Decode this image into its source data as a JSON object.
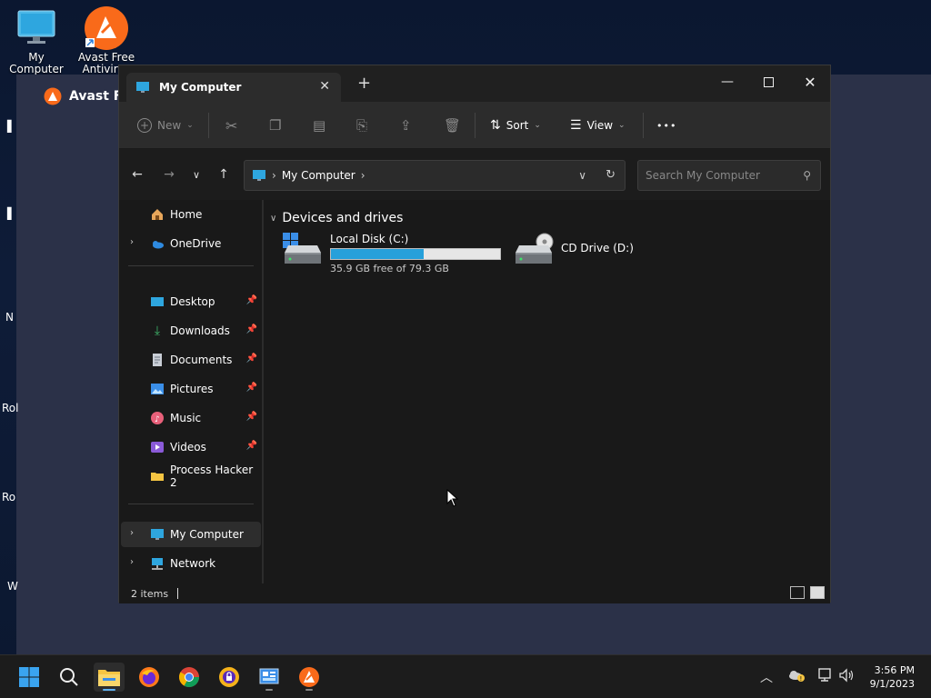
{
  "desktop": {
    "icons": [
      {
        "label": "My Computer"
      },
      {
        "label": "Avast Free Antivirus"
      }
    ],
    "strip_marks": [
      "N",
      "Rol",
      "Ro",
      "W"
    ]
  },
  "avast_window": {
    "title": "Avast Free Antivirus"
  },
  "explorer": {
    "tab_title": "My Computer",
    "new_tab": "+",
    "toolbar": {
      "new_label": "New",
      "sort_label": "Sort",
      "view_label": "View",
      "more_label": "•••"
    },
    "address": {
      "path": "My Computer"
    },
    "search": {
      "placeholder": "Search My Computer"
    },
    "sidebar": {
      "home": "Home",
      "onedrive": "OneDrive",
      "pinned": [
        {
          "label": "Desktop"
        },
        {
          "label": "Downloads"
        },
        {
          "label": "Documents"
        },
        {
          "label": "Pictures"
        },
        {
          "label": "Music"
        },
        {
          "label": "Videos"
        },
        {
          "label": "Process Hacker 2"
        }
      ],
      "my_computer": "My Computer",
      "network": "Network"
    },
    "content": {
      "group_title": "Devices and drives",
      "drives": [
        {
          "name": "Local Disk (C:)",
          "free_text": "35.9 GB free of 79.3 GB",
          "used_fraction": 0.547
        },
        {
          "name": "CD Drive (D:)"
        }
      ]
    },
    "status": {
      "items_text": "2 items"
    }
  },
  "taskbar": {
    "time": "3:56 PM",
    "date": "9/1/2023",
    "accent": "#5fb2f2"
  }
}
